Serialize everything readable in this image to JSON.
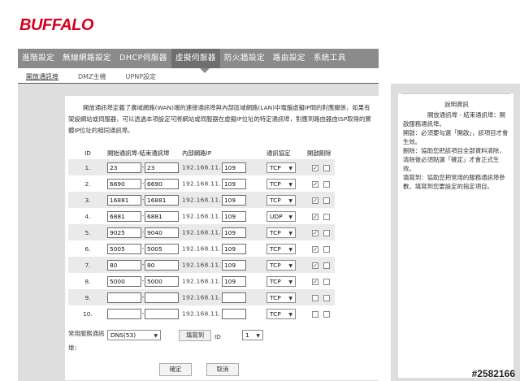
{
  "brand": "BUFFALO",
  "tabs": [
    "進階設定",
    "無線網路設定",
    "DHCP伺服器",
    "虛擬伺服器",
    "防火牆設定",
    "路由設定",
    "系統工具"
  ],
  "active_tab": 3,
  "subtabs": [
    "開放通訊埠",
    "DMZ主機",
    "UPNP設定"
  ],
  "intro_text": "開放通訊埠定義了廣域網路(WAN)端的連接通訊埠與內部區域網路(LAN)中電腦虛擬IP間的對應關係，如果有架設網站或伺服器，可以透過本項設定可將網站或伺服器在虛擬IP位址的特定通訊埠，對應到路由器由ISP取得的實體IP位址的相同通訊埠。",
  "table": {
    "headers": {
      "id": "ID",
      "ports": "開始通訊埠-結束通訊埠",
      "ip": "內部網路IP",
      "proto": "通訊協定",
      "action": "開啟刪除"
    },
    "ip_prefix": "192.168.11.",
    "rows": [
      {
        "id": "1.",
        "start": "23",
        "end": "23",
        "ip": "109",
        "proto": "TCP",
        "enabled": true
      },
      {
        "id": "2.",
        "start": "6690",
        "end": "6690",
        "ip": "109",
        "proto": "TCP",
        "enabled": true
      },
      {
        "id": "3.",
        "start": "16881",
        "end": "16881",
        "ip": "109",
        "proto": "TCP",
        "enabled": true
      },
      {
        "id": "4.",
        "start": "6881",
        "end": "6881",
        "ip": "109",
        "proto": "UDP",
        "enabled": true
      },
      {
        "id": "5.",
        "start": "9025",
        "end": "9040",
        "ip": "109",
        "proto": "TCP",
        "enabled": true
      },
      {
        "id": "6.",
        "start": "5005",
        "end": "5005",
        "ip": "109",
        "proto": "TCP",
        "enabled": true
      },
      {
        "id": "7.",
        "start": "80",
        "end": "80",
        "ip": "109",
        "proto": "TCP",
        "enabled": true
      },
      {
        "id": "8.",
        "start": "5000",
        "end": "5000",
        "ip": "109",
        "proto": "TCP",
        "enabled": true
      },
      {
        "id": "9.",
        "start": "",
        "end": "",
        "ip": "",
        "proto": "TCP",
        "enabled": false
      },
      {
        "id": "10.",
        "start": "",
        "end": "",
        "ip": "",
        "proto": "TCP",
        "enabled": false
      }
    ]
  },
  "common_service_label": "常用服務通訊埠：",
  "dns_select": "DNS(53)",
  "fill_button": "填寫到",
  "id_label": "ID",
  "id_select": "1",
  "ok_button": "確定",
  "cancel_button": "取消",
  "help": {
    "title": "說明資訊",
    "paras": [
      "開放通訊埠 - 結束通訊埠：開啟服務通訊埠。",
      "開啟：必須要勾選「開啟」，該項目才會生效。",
      "刪除：協助您把該項目全部資料清除，清除後必須點選「確定」才會正式生效。",
      "填寫到：協助您把常用的服務通訊埠參數，填寫到您要設定的指定項目。"
    ]
  },
  "watermark": "#2582166"
}
